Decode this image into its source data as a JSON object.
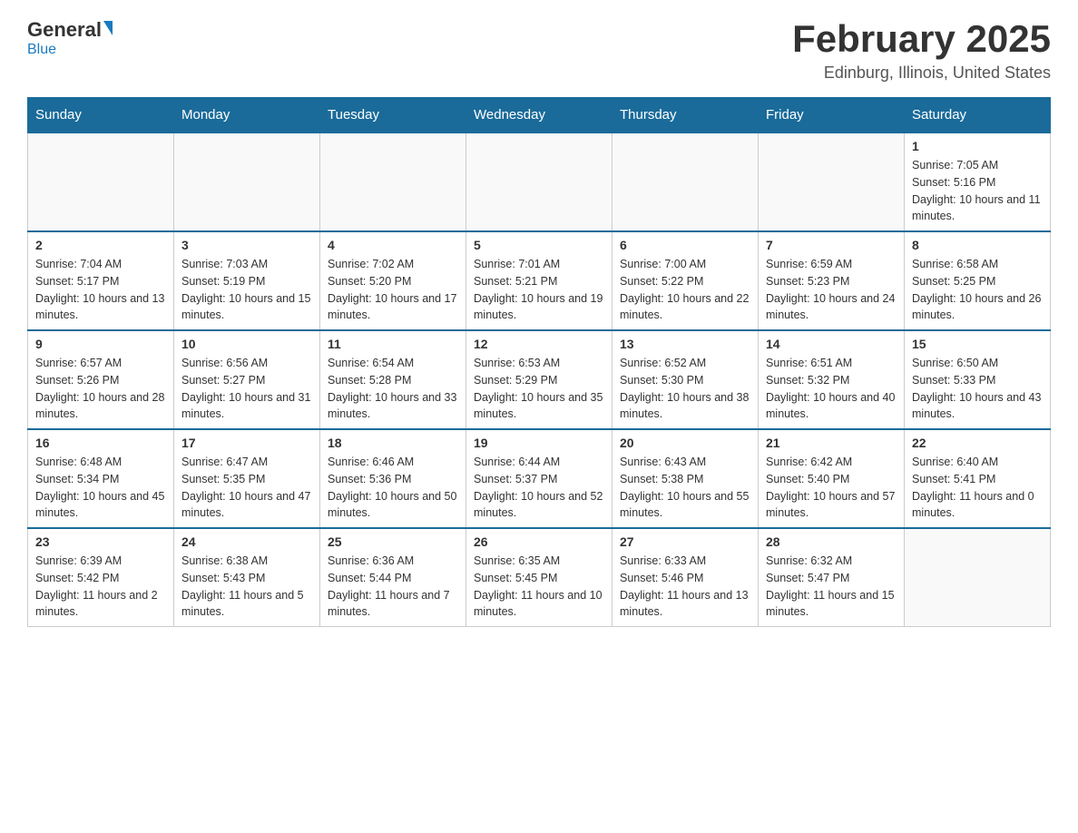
{
  "logo": {
    "general": "General",
    "blue": "Blue"
  },
  "title": "February 2025",
  "subtitle": "Edinburg, Illinois, United States",
  "days_of_week": [
    "Sunday",
    "Monday",
    "Tuesday",
    "Wednesday",
    "Thursday",
    "Friday",
    "Saturday"
  ],
  "weeks": [
    [
      {
        "day": "",
        "info": ""
      },
      {
        "day": "",
        "info": ""
      },
      {
        "day": "",
        "info": ""
      },
      {
        "day": "",
        "info": ""
      },
      {
        "day": "",
        "info": ""
      },
      {
        "day": "",
        "info": ""
      },
      {
        "day": "1",
        "info": "Sunrise: 7:05 AM\nSunset: 5:16 PM\nDaylight: 10 hours and 11 minutes."
      }
    ],
    [
      {
        "day": "2",
        "info": "Sunrise: 7:04 AM\nSunset: 5:17 PM\nDaylight: 10 hours and 13 minutes."
      },
      {
        "day": "3",
        "info": "Sunrise: 7:03 AM\nSunset: 5:19 PM\nDaylight: 10 hours and 15 minutes."
      },
      {
        "day": "4",
        "info": "Sunrise: 7:02 AM\nSunset: 5:20 PM\nDaylight: 10 hours and 17 minutes."
      },
      {
        "day": "5",
        "info": "Sunrise: 7:01 AM\nSunset: 5:21 PM\nDaylight: 10 hours and 19 minutes."
      },
      {
        "day": "6",
        "info": "Sunrise: 7:00 AM\nSunset: 5:22 PM\nDaylight: 10 hours and 22 minutes."
      },
      {
        "day": "7",
        "info": "Sunrise: 6:59 AM\nSunset: 5:23 PM\nDaylight: 10 hours and 24 minutes."
      },
      {
        "day": "8",
        "info": "Sunrise: 6:58 AM\nSunset: 5:25 PM\nDaylight: 10 hours and 26 minutes."
      }
    ],
    [
      {
        "day": "9",
        "info": "Sunrise: 6:57 AM\nSunset: 5:26 PM\nDaylight: 10 hours and 28 minutes."
      },
      {
        "day": "10",
        "info": "Sunrise: 6:56 AM\nSunset: 5:27 PM\nDaylight: 10 hours and 31 minutes."
      },
      {
        "day": "11",
        "info": "Sunrise: 6:54 AM\nSunset: 5:28 PM\nDaylight: 10 hours and 33 minutes."
      },
      {
        "day": "12",
        "info": "Sunrise: 6:53 AM\nSunset: 5:29 PM\nDaylight: 10 hours and 35 minutes."
      },
      {
        "day": "13",
        "info": "Sunrise: 6:52 AM\nSunset: 5:30 PM\nDaylight: 10 hours and 38 minutes."
      },
      {
        "day": "14",
        "info": "Sunrise: 6:51 AM\nSunset: 5:32 PM\nDaylight: 10 hours and 40 minutes."
      },
      {
        "day": "15",
        "info": "Sunrise: 6:50 AM\nSunset: 5:33 PM\nDaylight: 10 hours and 43 minutes."
      }
    ],
    [
      {
        "day": "16",
        "info": "Sunrise: 6:48 AM\nSunset: 5:34 PM\nDaylight: 10 hours and 45 minutes."
      },
      {
        "day": "17",
        "info": "Sunrise: 6:47 AM\nSunset: 5:35 PM\nDaylight: 10 hours and 47 minutes."
      },
      {
        "day": "18",
        "info": "Sunrise: 6:46 AM\nSunset: 5:36 PM\nDaylight: 10 hours and 50 minutes."
      },
      {
        "day": "19",
        "info": "Sunrise: 6:44 AM\nSunset: 5:37 PM\nDaylight: 10 hours and 52 minutes."
      },
      {
        "day": "20",
        "info": "Sunrise: 6:43 AM\nSunset: 5:38 PM\nDaylight: 10 hours and 55 minutes."
      },
      {
        "day": "21",
        "info": "Sunrise: 6:42 AM\nSunset: 5:40 PM\nDaylight: 10 hours and 57 minutes."
      },
      {
        "day": "22",
        "info": "Sunrise: 6:40 AM\nSunset: 5:41 PM\nDaylight: 11 hours and 0 minutes."
      }
    ],
    [
      {
        "day": "23",
        "info": "Sunrise: 6:39 AM\nSunset: 5:42 PM\nDaylight: 11 hours and 2 minutes."
      },
      {
        "day": "24",
        "info": "Sunrise: 6:38 AM\nSunset: 5:43 PM\nDaylight: 11 hours and 5 minutes."
      },
      {
        "day": "25",
        "info": "Sunrise: 6:36 AM\nSunset: 5:44 PM\nDaylight: 11 hours and 7 minutes."
      },
      {
        "day": "26",
        "info": "Sunrise: 6:35 AM\nSunset: 5:45 PM\nDaylight: 11 hours and 10 minutes."
      },
      {
        "day": "27",
        "info": "Sunrise: 6:33 AM\nSunset: 5:46 PM\nDaylight: 11 hours and 13 minutes."
      },
      {
        "day": "28",
        "info": "Sunrise: 6:32 AM\nSunset: 5:47 PM\nDaylight: 11 hours and 15 minutes."
      },
      {
        "day": "",
        "info": ""
      }
    ]
  ]
}
